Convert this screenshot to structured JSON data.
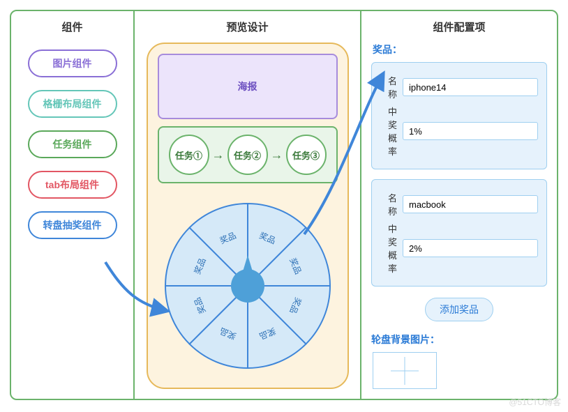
{
  "columns": {
    "sidebar_title": "组件",
    "preview_title": "预览设计",
    "config_title": "组件配置项"
  },
  "sidebar": {
    "items": [
      {
        "label": "图片组件",
        "color": "#8a6fd6"
      },
      {
        "label": "格栅布局组件",
        "color": "#64c6b8"
      },
      {
        "label": "任务组件",
        "color": "#5aa85a"
      },
      {
        "label": "tab布局组件",
        "color": "#e25663"
      },
      {
        "label": "转盘抽奖组件",
        "color": "#3f86d9"
      }
    ]
  },
  "preview": {
    "poster_label": "海报",
    "tasks": [
      "任务①",
      "任务②",
      "任务③"
    ],
    "wheel_segment_label": "奖品",
    "wheel_segments": 8
  },
  "config": {
    "prizes_label": "奖品：",
    "field_name_label": "名称",
    "field_prob_label": "中奖概率",
    "prizes": [
      {
        "name": "iphone14",
        "prob": "1%"
      },
      {
        "name": "macbook",
        "prob": "2%"
      }
    ],
    "add_button": "添加奖品",
    "bgimg_label": "轮盘背景图片："
  },
  "watermark": "@51CTO博客"
}
